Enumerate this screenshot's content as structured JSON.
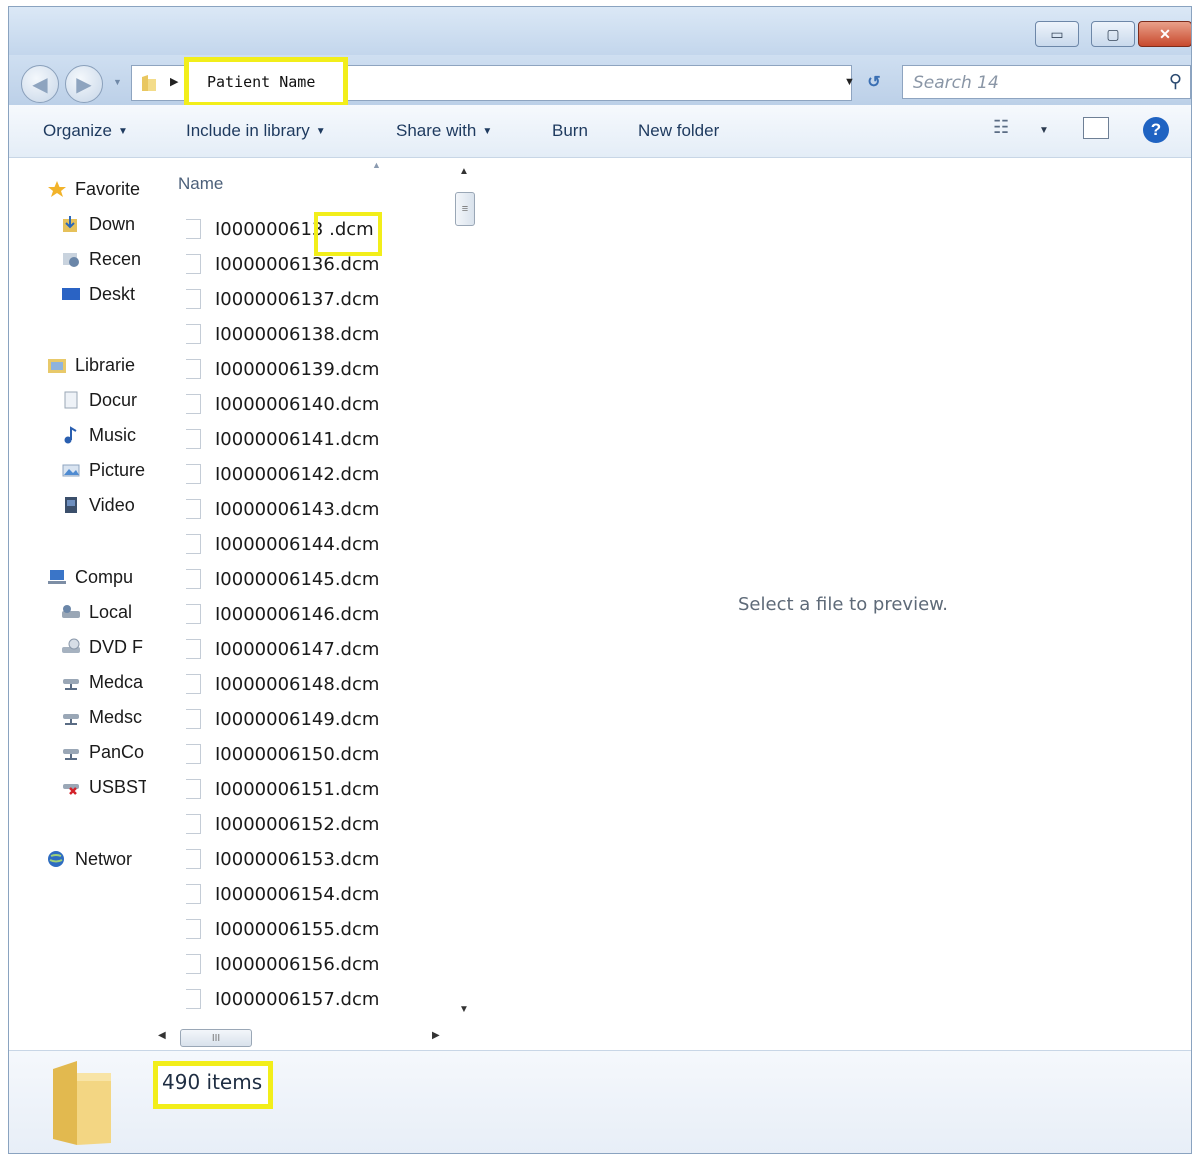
{
  "window": {
    "controls": [
      "minimize",
      "maximize",
      "close"
    ],
    "control_symbols": {
      "minimize": "▭",
      "maximize": "▢",
      "close": "✕"
    }
  },
  "address_bar": {
    "crumb": "Patient Name",
    "separator": "▶",
    "dropdown": "▼"
  },
  "search": {
    "placeholder": "Search 14",
    "icon": "search-icon",
    "symbol": "⚲"
  },
  "nav_buttons": {
    "back": "◀",
    "forward": "▶",
    "recent": "▼",
    "refresh": "↺"
  },
  "toolbar": {
    "organize": "Organize",
    "include": "Include in library",
    "share": "Share with",
    "burn": "Burn",
    "new_folder": "New folder",
    "caret": "▼",
    "views_symbol": "☷",
    "help_symbol": "?"
  },
  "nav_pane": {
    "favorites": "Favorite",
    "downloads": "Down",
    "recent": "Recen",
    "desktop": "Deskt",
    "libraries": "Librarie",
    "documents": "Docur",
    "music": "Music",
    "pictures": "Picture",
    "videos": "Video",
    "computer": "Compu",
    "local": "Local",
    "dvd": "DVD F",
    "medca": "Medca",
    "medsc": "Medsc",
    "panco": "PanCo",
    "usbst": "USBST",
    "network": "Networ"
  },
  "file_list": {
    "column_name": "Name",
    "sort_symbol": "▲",
    "files": [
      "I000000613 .dcm",
      "I0000006136.dcm",
      "I0000006137.dcm",
      "I0000006138.dcm",
      "I0000006139.dcm",
      "I0000006140.dcm",
      "I0000006141.dcm",
      "I0000006142.dcm",
      "I0000006143.dcm",
      "I0000006144.dcm",
      "I0000006145.dcm",
      "I0000006146.dcm",
      "I0000006147.dcm",
      "I0000006148.dcm",
      "I0000006149.dcm",
      "I0000006150.dcm",
      "I0000006151.dcm",
      "I0000006152.dcm",
      "I0000006153.dcm",
      "I0000006154.dcm",
      "I0000006155.dcm",
      "I0000006156.dcm",
      "I0000006157.dcm"
    ]
  },
  "scrollbars": {
    "up": "▲",
    "down": "▼",
    "left": "◀",
    "right": "▶",
    "grip_v": "≡",
    "grip_h": "III"
  },
  "preview": {
    "text": "Select a file to preview."
  },
  "status": {
    "count": "490 items"
  },
  "colors": {
    "highlight": "#f2ee1a",
    "toolbar_text": "#1e3a5f",
    "folder": "#f0d27a"
  }
}
